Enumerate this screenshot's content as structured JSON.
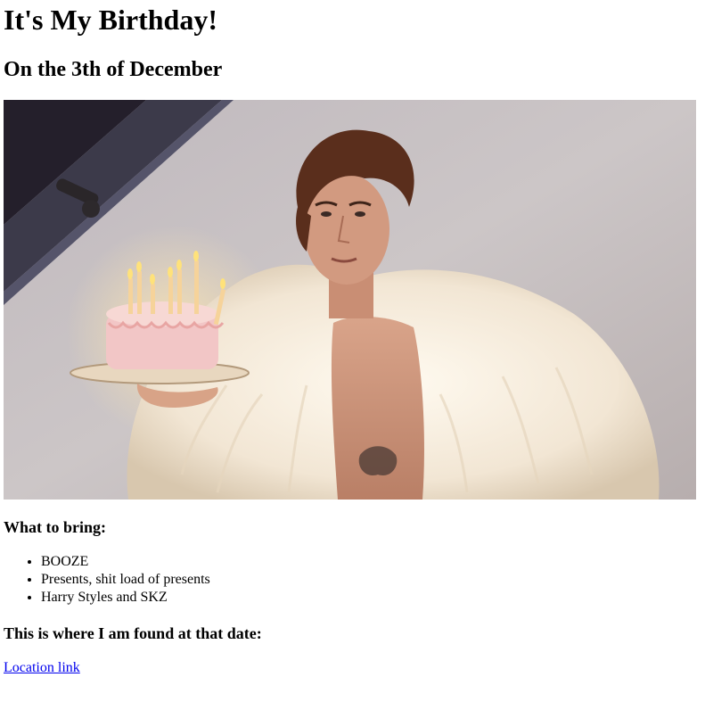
{
  "page": {
    "title": "It's My Birthday!",
    "subtitle": "On the 3th of December",
    "bring_heading": "What to bring:",
    "bring_items": [
      "BOOZE",
      "Presents, shit load of presents",
      "Harry Styles and SKZ"
    ],
    "where_heading": "This is where I am found at that date:",
    "location_link": "Location link"
  },
  "colors": {
    "link": "#0000ee",
    "wall": "#c9c3c4",
    "fur": "#f5ecdd",
    "cake": "#f3c9c8"
  }
}
